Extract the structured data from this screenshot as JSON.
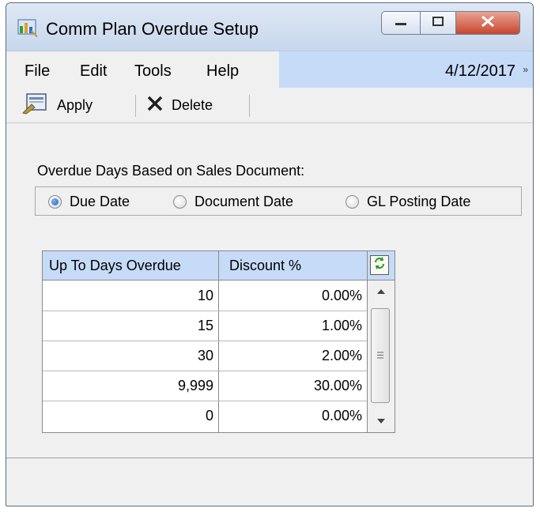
{
  "window": {
    "title": "Comm Plan Overdue Setup"
  },
  "menu": {
    "items": [
      "File",
      "Edit",
      "Tools",
      "Help"
    ],
    "date": "4/12/2017",
    "overflow": "»"
  },
  "toolbar": {
    "apply_label": "Apply",
    "delete_label": "Delete"
  },
  "overdue": {
    "group_label": "Overdue Days Based on Sales Document:",
    "options": [
      {
        "label": "Due Date",
        "selected": true
      },
      {
        "label": "Document Date",
        "selected": false
      },
      {
        "label": "GL Posting Date",
        "selected": false
      }
    ]
  },
  "table": {
    "columns": [
      "Up To Days Overdue",
      "Discount %"
    ],
    "rows": [
      {
        "days": "10",
        "discount": "0.00%"
      },
      {
        "days": "15",
        "discount": "1.00%"
      },
      {
        "days": "30",
        "discount": "2.00%"
      },
      {
        "days": "9,999",
        "discount": "30.00%"
      },
      {
        "days": "0",
        "discount": "0.00%"
      }
    ]
  }
}
